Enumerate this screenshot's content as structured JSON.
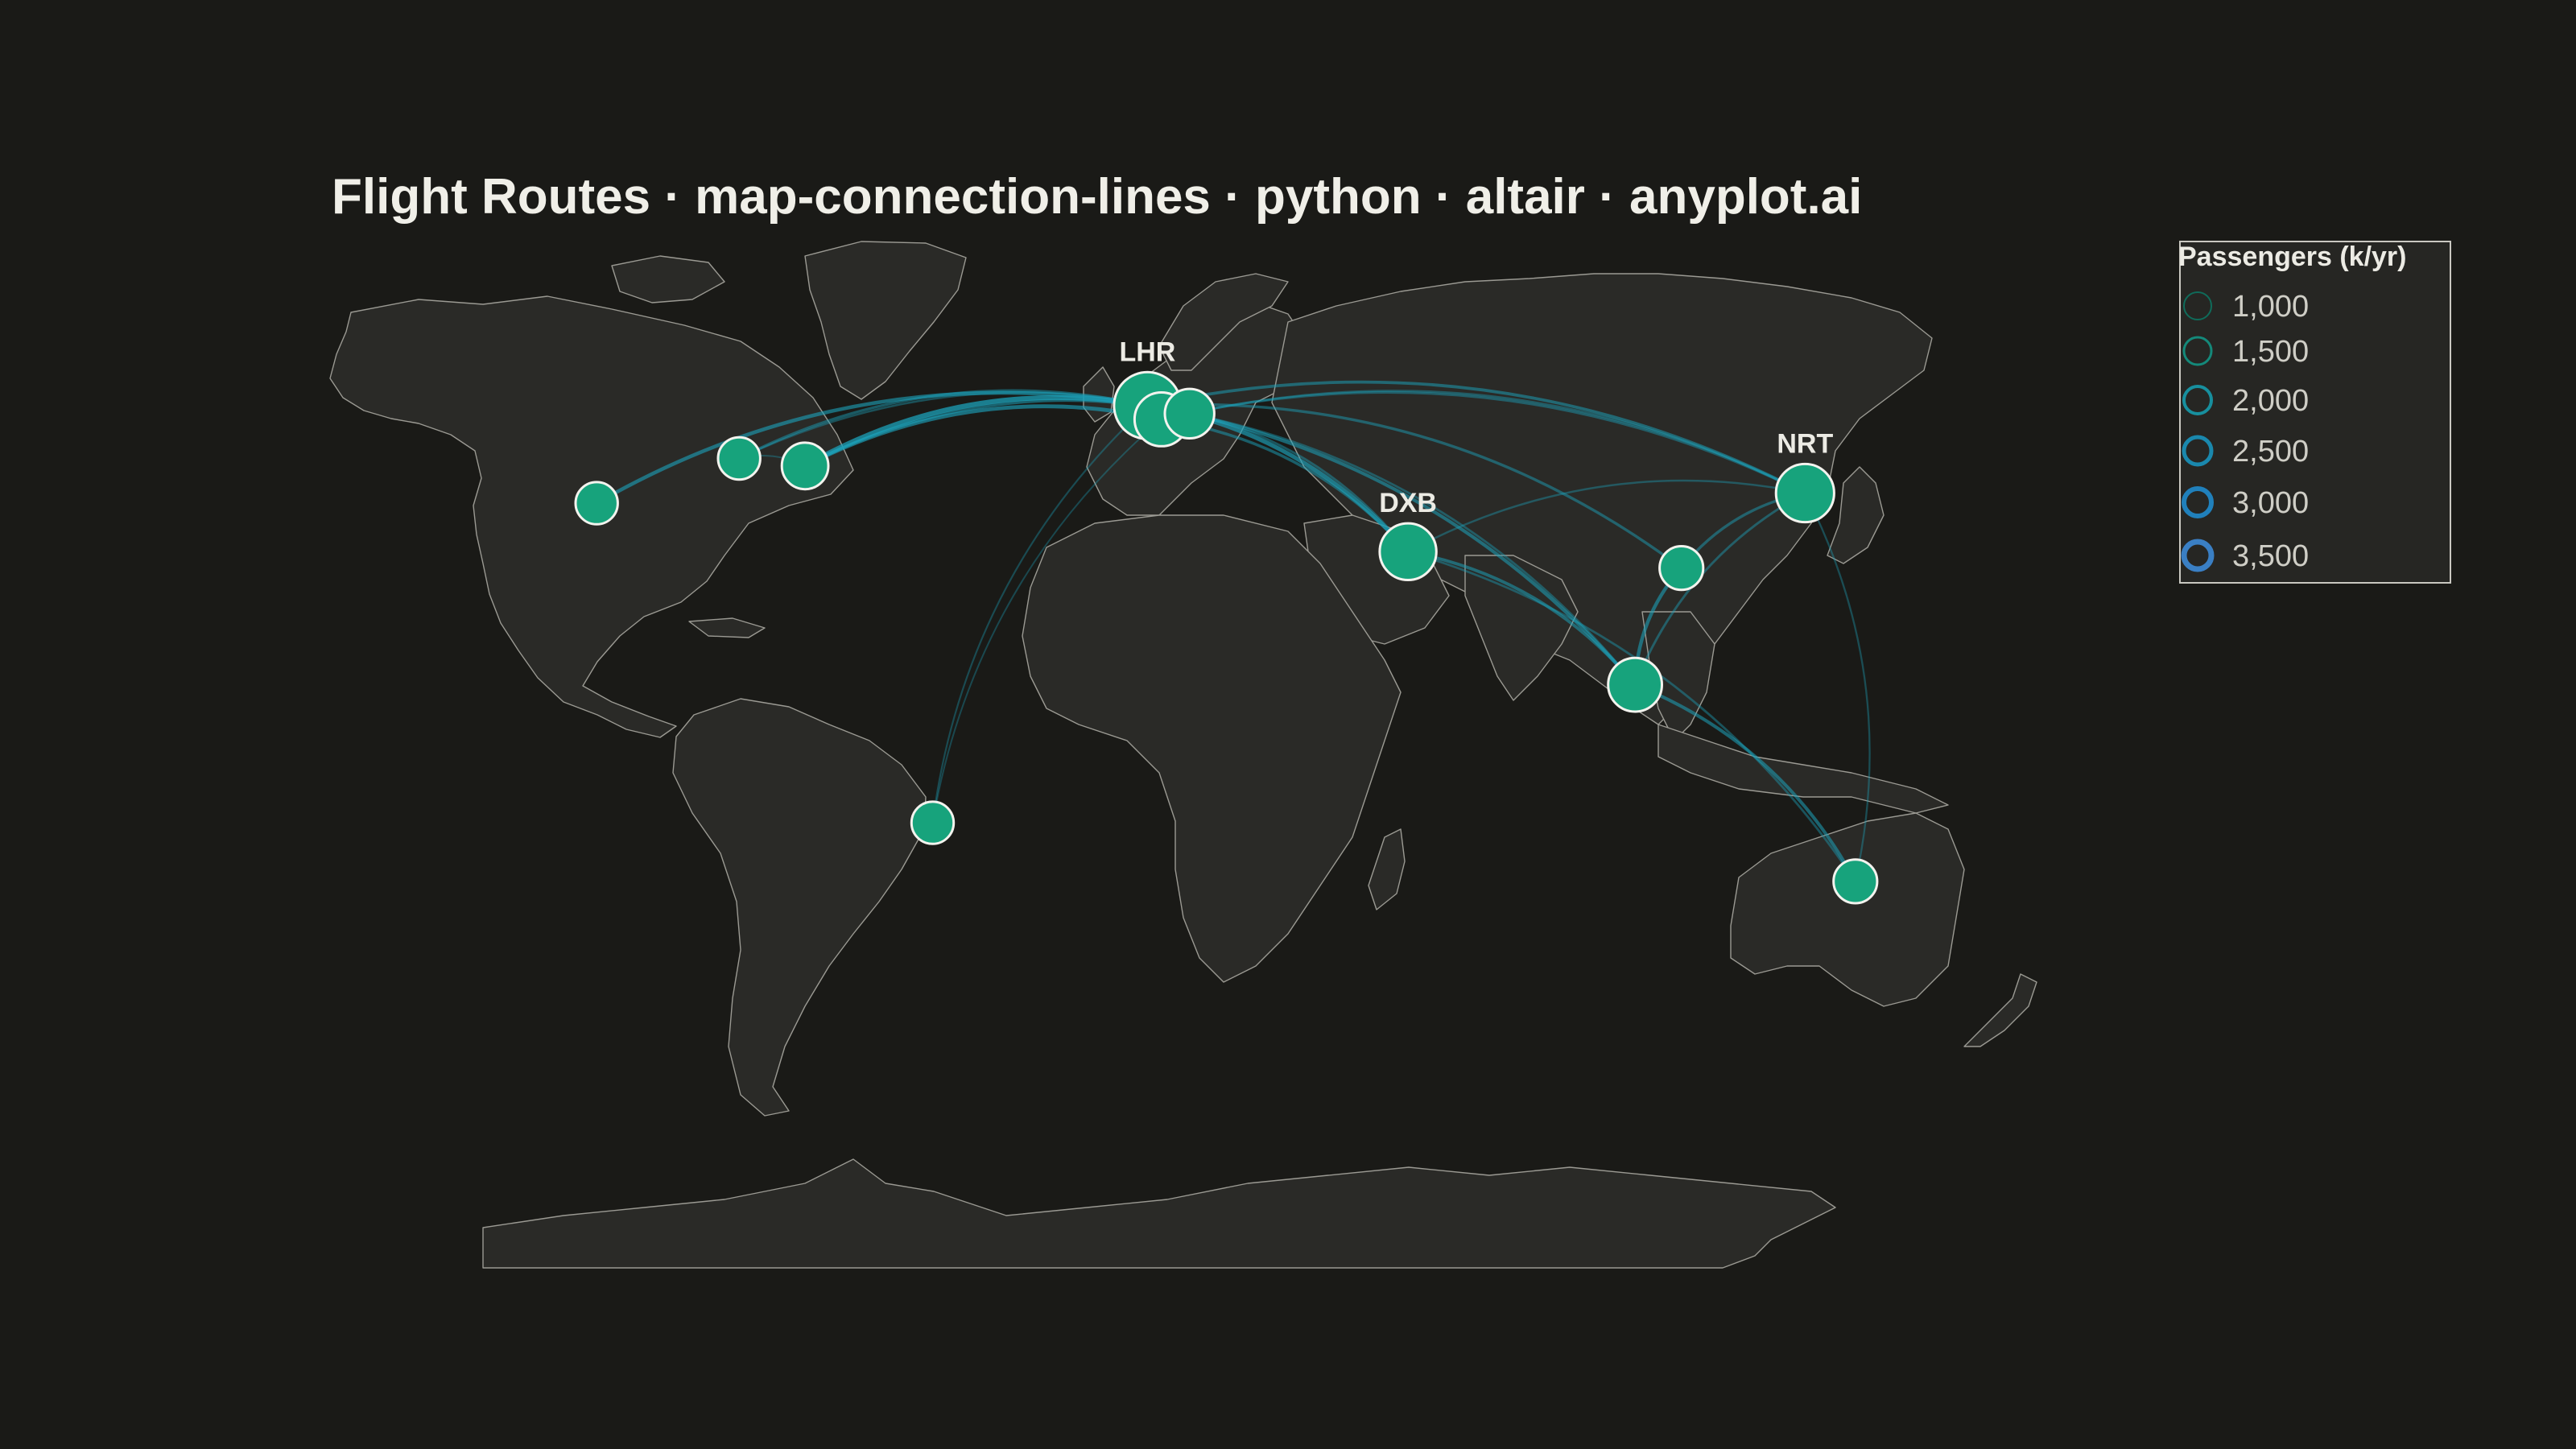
{
  "title": "Flight Routes · map-connection-lines · python · altair · anyplot.ai",
  "colors": {
    "background": "#1a1a17",
    "land": "#2a2a27",
    "border": "#9b9a93",
    "airport": "#17a37c",
    "route_low": "#0f7d6b",
    "route_high": "#3a7fc4"
  },
  "chart_data": {
    "type": "map",
    "projection": "equirectangular",
    "airports": [
      {
        "code": "LHR",
        "lon": -0.45,
        "lat": 51.47,
        "label": "LHR"
      },
      {
        "code": "CDG",
        "lon": 2.55,
        "lat": 49.01,
        "label": ""
      },
      {
        "code": "FRA",
        "lon": 8.57,
        "lat": 50.03,
        "label": ""
      },
      {
        "code": "DXB",
        "lon": 55.36,
        "lat": 25.25,
        "label": "DXB"
      },
      {
        "code": "NRT",
        "lon": 140.39,
        "lat": 35.77,
        "label": "NRT"
      },
      {
        "code": "HKG",
        "lon": 113.91,
        "lat": 22.31,
        "label": ""
      },
      {
        "code": "SIN",
        "lon": 103.99,
        "lat": 1.36,
        "label": ""
      },
      {
        "code": "SYD",
        "lon": 151.18,
        "lat": -33.94,
        "label": ""
      },
      {
        "code": "JFK",
        "lon": -73.78,
        "lat": 40.64,
        "label": ""
      },
      {
        "code": "ORD",
        "lon": -87.9,
        "lat": 41.98,
        "label": ""
      },
      {
        "code": "LAX",
        "lon": -118.41,
        "lat": 33.94,
        "label": ""
      },
      {
        "code": "GRU",
        "lon": -46.47,
        "lat": -23.43,
        "label": ""
      }
    ],
    "routes": [
      {
        "from": "LHR",
        "to": "JFK",
        "passengers": 3500
      },
      {
        "from": "CDG",
        "to": "JFK",
        "passengers": 2800
      },
      {
        "from": "FRA",
        "to": "JFK",
        "passengers": 2200
      },
      {
        "from": "LHR",
        "to": "ORD",
        "passengers": 1800
      },
      {
        "from": "LHR",
        "to": "LAX",
        "passengers": 2600
      },
      {
        "from": "FRA",
        "to": "ORD",
        "passengers": 1400
      },
      {
        "from": "LHR",
        "to": "DXB",
        "passengers": 3000
      },
      {
        "from": "CDG",
        "to": "DXB",
        "passengers": 2000
      },
      {
        "from": "FRA",
        "to": "DXB",
        "passengers": 1600
      },
      {
        "from": "LHR",
        "to": "SIN",
        "passengers": 2400
      },
      {
        "from": "FRA",
        "to": "SIN",
        "passengers": 1500
      },
      {
        "from": "LHR",
        "to": "HKG",
        "passengers": 1900
      },
      {
        "from": "LHR",
        "to": "NRT",
        "passengers": 2100
      },
      {
        "from": "CDG",
        "to": "NRT",
        "passengers": 1700
      },
      {
        "from": "FRA",
        "to": "NRT",
        "passengers": 1500
      },
      {
        "from": "DXB",
        "to": "SIN",
        "passengers": 2200
      },
      {
        "from": "DXB",
        "to": "SYD",
        "passengers": 1500
      },
      {
        "from": "DXB",
        "to": "NRT",
        "passengers": 1300
      },
      {
        "from": "SIN",
        "to": "SYD",
        "passengers": 2300
      },
      {
        "from": "HKG",
        "to": "SIN",
        "passengers": 2500
      },
      {
        "from": "NRT",
        "to": "HKG",
        "passengers": 1900
      },
      {
        "from": "NRT",
        "to": "SIN",
        "passengers": 1600
      },
      {
        "from": "NRT",
        "to": "SYD",
        "passengers": 1200
      },
      {
        "from": "LHR",
        "to": "GRU",
        "passengers": 1100
      },
      {
        "from": "CDG",
        "to": "GRU",
        "passengers": 1000
      },
      {
        "from": "ORD",
        "to": "JFK",
        "passengers": 1000
      }
    ],
    "hub_sizes": {
      "LHR": 3.5,
      "CDG": 2.6,
      "FRA": 2.3,
      "DXB": 2.8,
      "NRT": 2.9,
      "HKG": 1.9,
      "SIN": 2.6,
      "SYD": 1.9,
      "JFK": 2.1,
      "ORD": 1.8,
      "LAX": 1.8,
      "GRU": 1.8
    },
    "legend": {
      "title": "Passengers (k/yr)",
      "placement": "top-right",
      "entries": [
        {
          "value": 1000,
          "label": "1,000",
          "color": "#0f6b5a"
        },
        {
          "value": 1500,
          "label": "1,500",
          "color": "#14897a"
        },
        {
          "value": 2000,
          "label": "2,000",
          "color": "#178f9e"
        },
        {
          "value": 2500,
          "label": "2,500",
          "color": "#1a88ad"
        },
        {
          "value": 3000,
          "label": "3,000",
          "color": "#2080bb"
        },
        {
          "value": 3500,
          "label": "3,500",
          "color": "#3a7fc4"
        }
      ]
    }
  }
}
